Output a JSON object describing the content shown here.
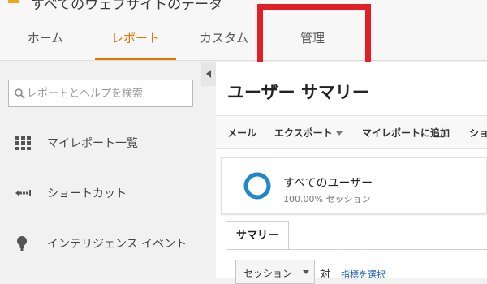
{
  "app": {
    "title": "すべてのウェブサイトのデータ"
  },
  "topnav": {
    "tabs": [
      {
        "label": "ホーム",
        "active": false
      },
      {
        "label": "レポート",
        "active": true
      },
      {
        "label": "カスタム",
        "active": false
      },
      {
        "label": "管理",
        "active": false
      }
    ],
    "accent_color": "#e37400",
    "highlight_color": "#e01f26"
  },
  "sidebar": {
    "search": {
      "placeholder": "レポートとヘルプを検索",
      "value": "",
      "icon": "search-icon"
    },
    "items": [
      {
        "label": "マイレポート一覧",
        "icon": "grid-icon"
      },
      {
        "label": "ショートカット",
        "icon": "shortcut-arrow-icon"
      },
      {
        "label": "インテリジェンス イベント",
        "icon": "lightbulb-icon"
      }
    ]
  },
  "main": {
    "title": "ユーザー サマリー",
    "actions": [
      {
        "label": "メール"
      },
      {
        "label": "エクスポート",
        "dropdown": true
      },
      {
        "label": "マイレポートに追加"
      },
      {
        "label": "ショ"
      }
    ],
    "segment": {
      "name": "すべてのユーザー",
      "subtitle": "100.00% セッション",
      "ring_color": "#1e88c8"
    },
    "tabs": [
      {
        "label": "サマリー",
        "active": true
      }
    ],
    "metric_selector": {
      "value": "セッション",
      "vs_label": "対",
      "link_label": "指標を選択"
    }
  }
}
